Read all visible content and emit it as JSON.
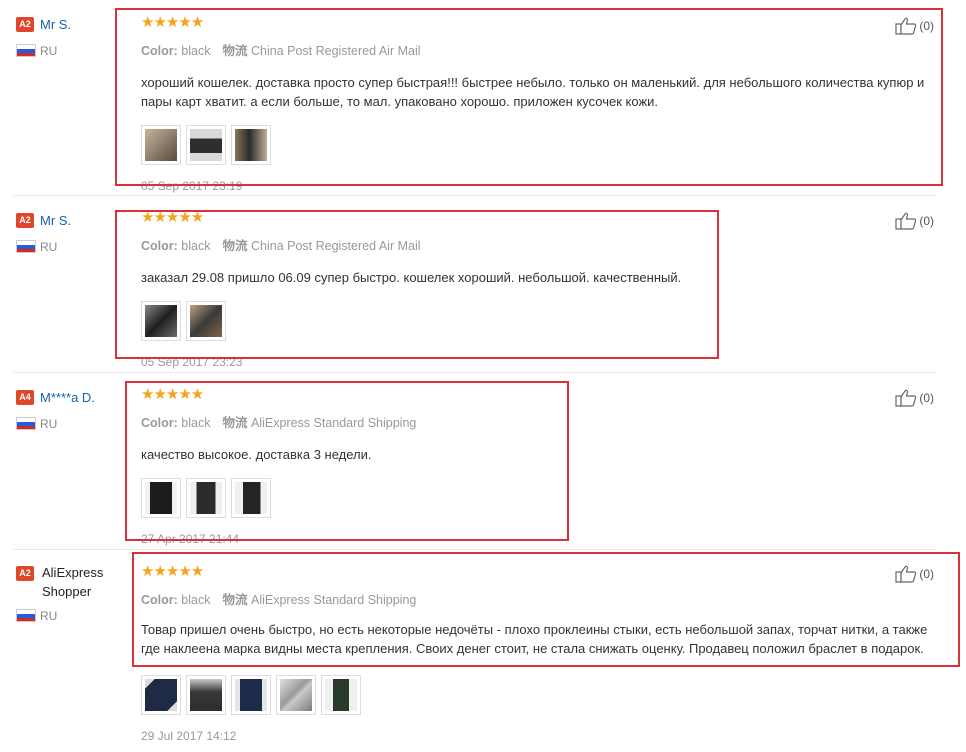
{
  "color_label": "Color:",
  "shipping_label": "物流",
  "reviews": [
    {
      "level": "A2",
      "name": "Mr S.",
      "country": "RU",
      "stars": "★★★★★",
      "color": "black",
      "shipping": "China Post Registered Air Mail",
      "text": "хороший кошелек. доставка просто супер быстрая!!! быстрее небыло. только он маленький. для небольшого количества купюр и пары карт хватит. а если больше, то мал. упаковано хорошо. приложен кусочек кожи.",
      "date": "05 Sep 2017 23:19",
      "likes": "(0)",
      "thumbs": [
        "#5a4a3a",
        "#2e2e2e",
        "#8a7660"
      ]
    },
    {
      "level": "A2",
      "name": "Mr S.",
      "country": "RU",
      "stars": "★★★★★",
      "color": "black",
      "shipping": "China Post Registered Air Mail",
      "text": "заказал 29.08 пришло 06.09 супер быстро. кошелек хороший. небольшой. качественный.",
      "date": "05 Sep 2017 23:23",
      "likes": "(0)",
      "thumbs": [
        "#2a2a2a",
        "#7d6448"
      ]
    },
    {
      "level": "A4",
      "name": "M****a D.",
      "country": "RU",
      "stars": "★★★★★",
      "color": "black",
      "shipping": "AliExpress Standard Shipping",
      "text": "качество высокое. доставка 3 недели.",
      "date": "27 Apr 2017 21:44",
      "likes": "(0)",
      "thumbs": [
        "#1c1c1c",
        "#2b2b2b",
        "#242424"
      ]
    },
    {
      "level": "A2",
      "name": "AliExpress Shopper",
      "country": "RU",
      "stars": "★★★★★",
      "color": "black",
      "shipping": "AliExpress Standard Shipping",
      "text": "Товар пришел очень быстро, но есть некоторые недочёты - плохо проклеины стыки, есть небольшой запах, торчат нитки, а также где наклеена марка видны места крепления. Своих денег стоит, не стала снижать оценку. Продавец положил браслет в подарок.",
      "date": "29 Jul 2017 14:12",
      "likes": "(0)",
      "thumbs": [
        "#1f2a44",
        "#3a3a3a",
        "#1e2a4a",
        "#9a9a9a",
        "#2a3a2a"
      ]
    }
  ]
}
